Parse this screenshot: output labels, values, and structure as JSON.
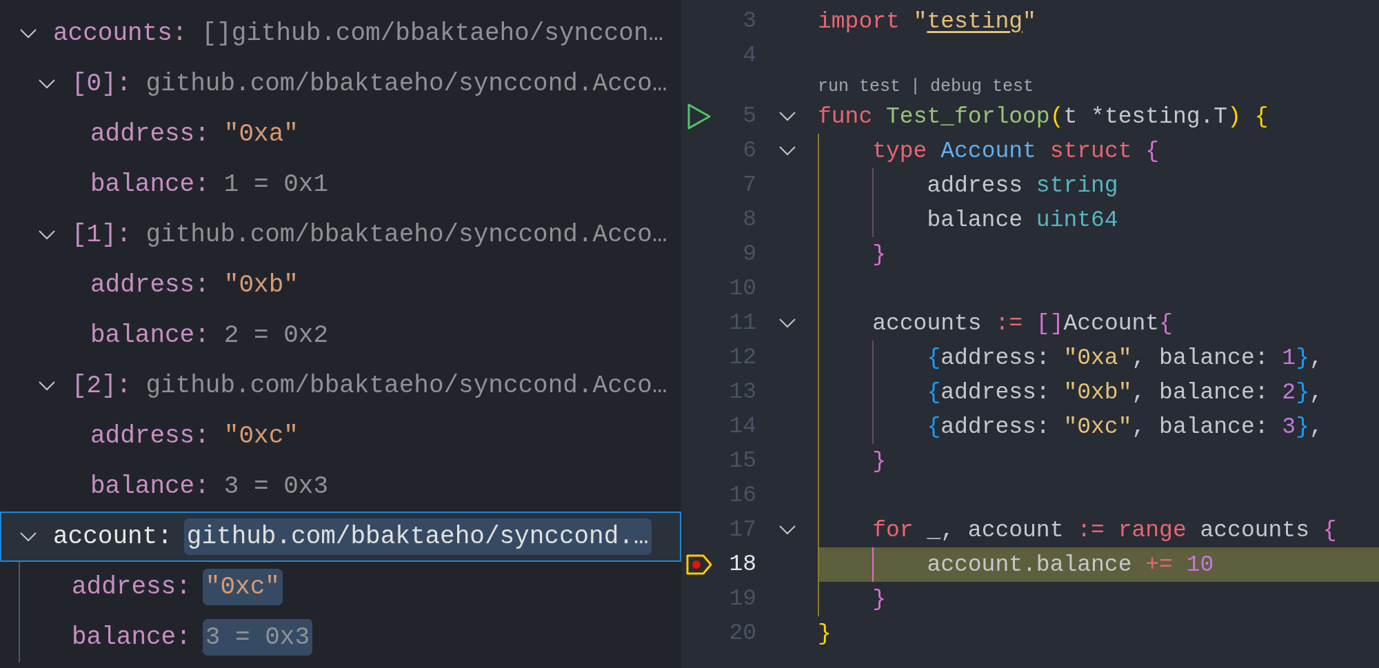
{
  "variables": [
    {
      "name": "accounts:",
      "value": "[]github.com/bbaktaeho/synccon…",
      "expanded": true,
      "selected": false,
      "changed": false,
      "children": [
        {
          "name": "[0]:",
          "value": "github.com/bbaktaeho/synccond.Acco…",
          "expanded": true,
          "selected": false,
          "changed": false,
          "children": [
            {
              "name": "address:",
              "value": "\"0xa\"",
              "kind": "string",
              "selected": false,
              "changed": false
            },
            {
              "name": "balance:",
              "value": "1 = 0x1",
              "selected": false,
              "changed": false
            }
          ]
        },
        {
          "name": "[1]:",
          "value": "github.com/bbaktaeho/synccond.Acco…",
          "expanded": true,
          "selected": false,
          "changed": false,
          "children": [
            {
              "name": "address:",
              "value": "\"0xb\"",
              "kind": "string",
              "selected": false,
              "changed": false
            },
            {
              "name": "balance:",
              "value": "2 = 0x2",
              "selected": false,
              "changed": false
            }
          ]
        },
        {
          "name": "[2]:",
          "value": "github.com/bbaktaeho/synccond.Acco…",
          "expanded": true,
          "selected": false,
          "changed": false,
          "children": [
            {
              "name": "address:",
              "value": "\"0xc\"",
              "kind": "string",
              "selected": false,
              "changed": false
            },
            {
              "name": "balance:",
              "value": "3 = 0x3",
              "selected": false,
              "changed": false
            }
          ]
        }
      ]
    },
    {
      "name": "account:",
      "value": "github.com/bbaktaeho/synccond.…",
      "expanded": true,
      "selected": true,
      "changed": true,
      "children": [
        {
          "name": "address:",
          "value": "\"0xc\"",
          "kind": "string",
          "selected": false,
          "changed": true
        },
        {
          "name": "balance:",
          "value": "3 = 0x3",
          "selected": false,
          "changed": true
        }
      ]
    }
  ],
  "editor": {
    "lines": [
      {
        "number": "3",
        "tokens": [
          {
            "text": "import ",
            "kind": "keyword"
          },
          {
            "text": "\"",
            "kind": "string"
          },
          {
            "text": "testing",
            "kind": "link"
          },
          {
            "text": "\"",
            "kind": "string"
          }
        ]
      },
      {
        "number": "4"
      },
      {
        "number": "5",
        "runnable": true,
        "foldable": true,
        "codelens": {
          "links": [
            "run test",
            "debug test"
          ],
          "separator": "|"
        },
        "tokens": [
          {
            "text": "func ",
            "kind": "keyword"
          },
          {
            "text": "Test_forloop",
            "kind": "function"
          },
          {
            "text": "(",
            "kind": "bracket1"
          },
          {
            "text": "t *testing.T",
            "kind": "plain"
          },
          {
            "text": ")",
            "kind": "bracket1"
          },
          {
            "text": " {",
            "kind": "bracket1"
          }
        ],
        "children": [
          {
            "number": "6",
            "foldable": true,
            "tokens": [
              {
                "text": "type ",
                "kind": "keyword"
              },
              {
                "text": "Account",
                "kind": "type"
              },
              {
                "text": " struct",
                "kind": "keyword"
              },
              {
                "text": " {",
                "kind": "bracket2"
              }
            ],
            "children": [
              {
                "number": "7",
                "tokens": [
                  {
                    "text": "address ",
                    "kind": "plain"
                  },
                  {
                    "text": "string",
                    "kind": "builtin"
                  }
                ]
              },
              {
                "number": "8",
                "tokens": [
                  {
                    "text": "balance ",
                    "kind": "plain"
                  },
                  {
                    "text": "uint64",
                    "kind": "builtin"
                  }
                ]
              }
            ]
          },
          {
            "number": "9",
            "tokens": [
              {
                "text": "}",
                "kind": "bracket2"
              }
            ]
          },
          {
            "number": "10"
          },
          {
            "number": "11",
            "foldable": true,
            "tokens": [
              {
                "text": "accounts ",
                "kind": "plain"
              },
              {
                "text": ":= ",
                "kind": "keyword"
              },
              {
                "text": "[]",
                "kind": "bracket2"
              },
              {
                "text": "Account",
                "kind": "plain"
              },
              {
                "text": "{",
                "kind": "bracket2"
              }
            ],
            "children": [
              {
                "number": "12",
                "tokens": [
                  {
                    "text": "{",
                    "kind": "bracket3"
                  },
                  {
                    "text": "address: ",
                    "kind": "plain"
                  },
                  {
                    "text": "\"0xa\"",
                    "kind": "string"
                  },
                  {
                    "text": ", balance: ",
                    "kind": "plain"
                  },
                  {
                    "text": "1",
                    "kind": "number"
                  },
                  {
                    "text": "}",
                    "kind": "bracket3"
                  },
                  {
                    "text": ",",
                    "kind": "plain"
                  }
                ]
              },
              {
                "number": "13",
                "tokens": [
                  {
                    "text": "{",
                    "kind": "bracket3"
                  },
                  {
                    "text": "address: ",
                    "kind": "plain"
                  },
                  {
                    "text": "\"0xb\"",
                    "kind": "string"
                  },
                  {
                    "text": ", balance: ",
                    "kind": "plain"
                  },
                  {
                    "text": "2",
                    "kind": "number"
                  },
                  {
                    "text": "}",
                    "kind": "bracket3"
                  },
                  {
                    "text": ",",
                    "kind": "plain"
                  }
                ]
              },
              {
                "number": "14",
                "tokens": [
                  {
                    "text": "{",
                    "kind": "bracket3"
                  },
                  {
                    "text": "address: ",
                    "kind": "plain"
                  },
                  {
                    "text": "\"0xc\"",
                    "kind": "string"
                  },
                  {
                    "text": ", balance: ",
                    "kind": "plain"
                  },
                  {
                    "text": "3",
                    "kind": "number"
                  },
                  {
                    "text": "}",
                    "kind": "bracket3"
                  },
                  {
                    "text": ",",
                    "kind": "plain"
                  }
                ]
              }
            ]
          },
          {
            "number": "15",
            "tokens": [
              {
                "text": "}",
                "kind": "bracket2"
              }
            ]
          },
          {
            "number": "16"
          },
          {
            "number": "17",
            "foldable": true,
            "tokens": [
              {
                "text": "for",
                "kind": "keyword"
              },
              {
                "text": " _, account ",
                "kind": "plain"
              },
              {
                "text": ":=",
                "kind": "keyword"
              },
              {
                "text": " range",
                "kind": "keyword"
              },
              {
                "text": " accounts ",
                "kind": "plain"
              },
              {
                "text": "{",
                "kind": "bracket2"
              }
            ],
            "children": [
              {
                "number": "18",
                "stack_frame": true,
                "current": true,
                "tokens": [
                  {
                    "text": "account.balance ",
                    "kind": "plain"
                  },
                  {
                    "text": "+= ",
                    "kind": "keyword"
                  },
                  {
                    "text": "10",
                    "kind": "number"
                  }
                ]
              }
            ]
          },
          {
            "number": "19",
            "tokens": [
              {
                "text": "}",
                "kind": "bracket2"
              }
            ]
          }
        ]
      },
      {
        "number": "20",
        "tokens": [
          {
            "text": "}",
            "kind": "bracket1"
          }
        ]
      }
    ]
  }
}
